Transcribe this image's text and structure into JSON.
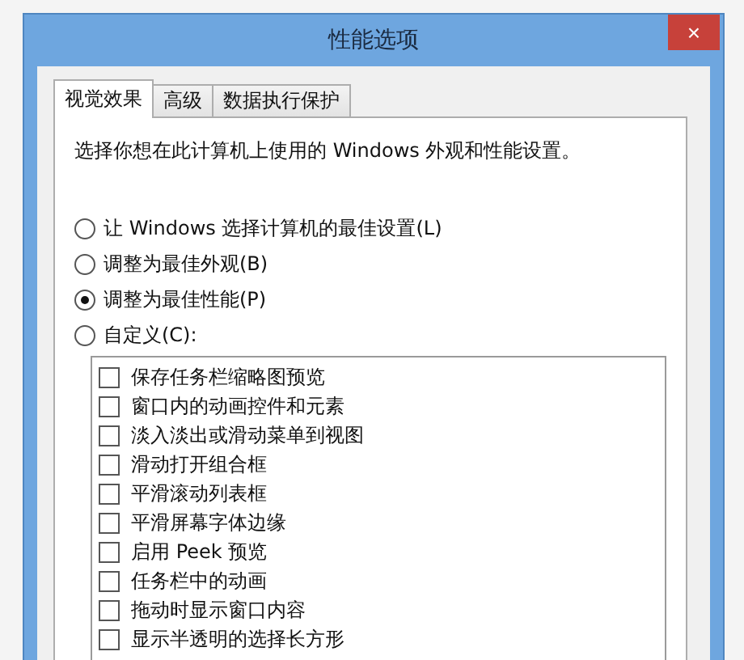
{
  "window": {
    "title": "性能选项",
    "close": "×"
  },
  "tabs": [
    {
      "label": "视觉效果",
      "selected": true
    },
    {
      "label": "高级",
      "selected": false
    },
    {
      "label": "数据执行保护",
      "selected": false
    }
  ],
  "description": "选择你想在此计算机上使用的 Windows 外观和性能设置。",
  "options": [
    {
      "label": "让 Windows 选择计算机的最佳设置(L)",
      "selected": false
    },
    {
      "label": "调整为最佳外观(B)",
      "selected": false
    },
    {
      "label": "调整为最佳性能(P)",
      "selected": true
    },
    {
      "label": "自定义(C):",
      "selected": false
    }
  ],
  "effects": [
    {
      "label": "保存任务栏缩略图预览",
      "checked": false
    },
    {
      "label": "窗口内的动画控件和元素",
      "checked": false
    },
    {
      "label": "淡入淡出或滑动菜单到视图",
      "checked": false
    },
    {
      "label": "滑动打开组合框",
      "checked": false
    },
    {
      "label": "平滑滚动列表框",
      "checked": false
    },
    {
      "label": "平滑屏幕字体边缘",
      "checked": false
    },
    {
      "label": "启用 Peek 预览",
      "checked": false
    },
    {
      "label": "任务栏中的动画",
      "checked": false
    },
    {
      "label": "拖动时显示窗口内容",
      "checked": false
    },
    {
      "label": "显示半透明的选择长方形",
      "checked": false
    }
  ]
}
